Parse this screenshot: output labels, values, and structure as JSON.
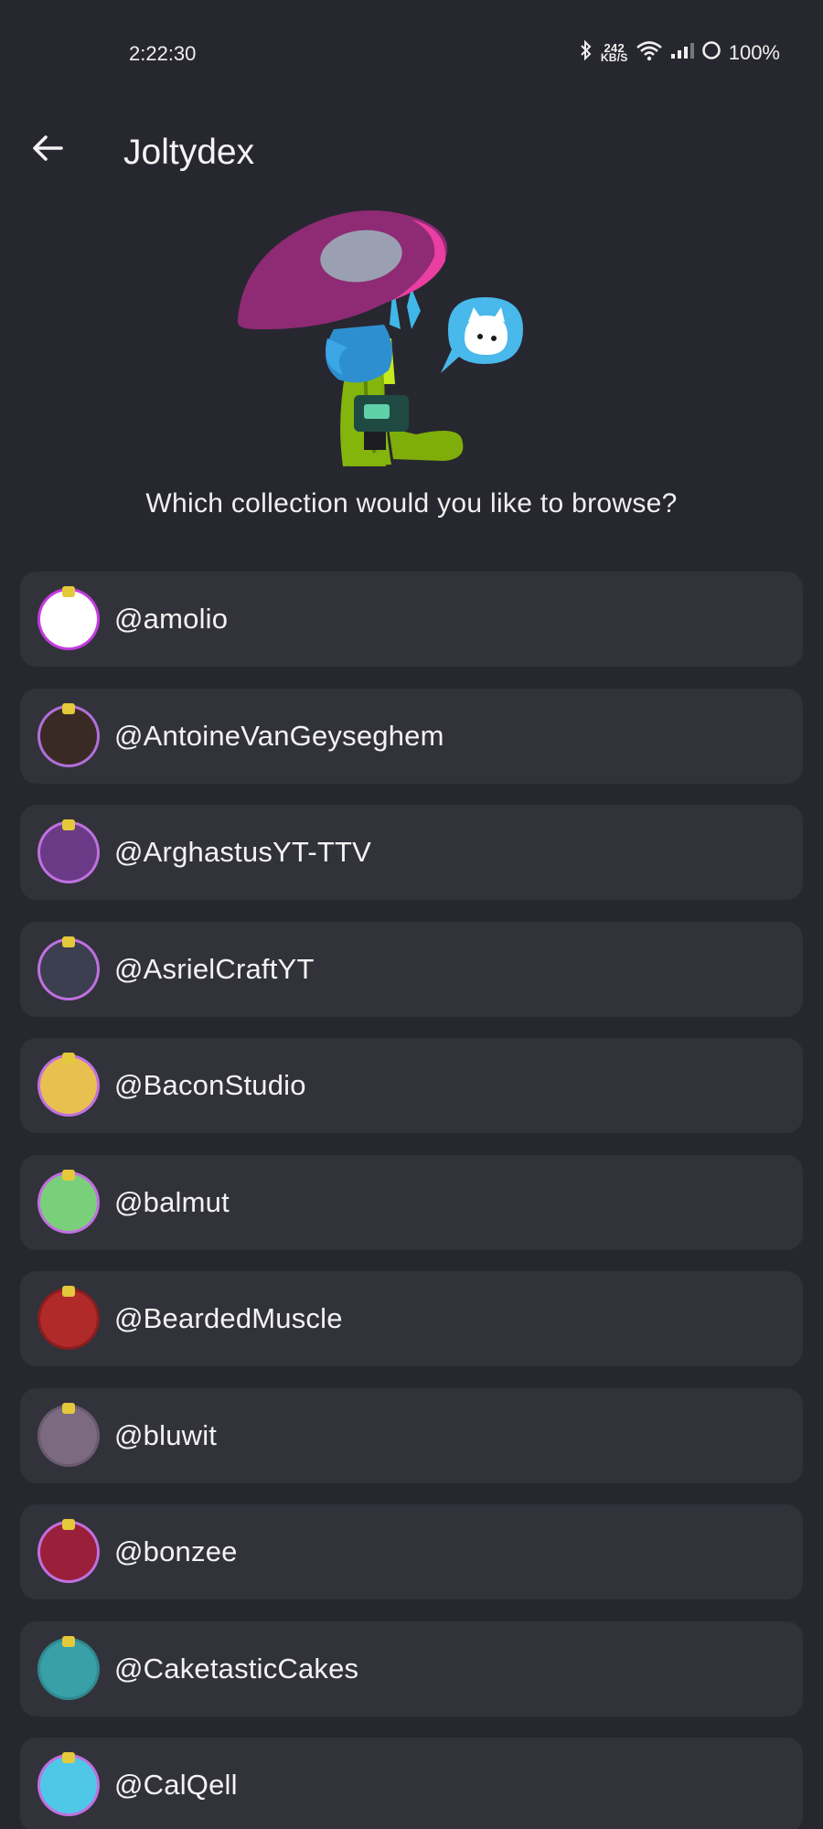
{
  "status_bar": {
    "time": "2:22:30",
    "net_speed_value": "242",
    "net_speed_unit": "KB/S",
    "battery": "100%"
  },
  "app_bar": {
    "title": "Joltydex"
  },
  "prompt": "Which collection would you like to browse?",
  "collections": [
    {
      "username": "@amolio",
      "avatar_color": "#ffffff",
      "ring_color": "#c43be0"
    },
    {
      "username": "@AntoineVanGeyseghem",
      "avatar_color": "#3a2a26",
      "ring_color": "#b070d8"
    },
    {
      "username": "@ArghastusYT-TTV",
      "avatar_color": "#6a3a86",
      "ring_color": "#c070e0"
    },
    {
      "username": "@AsrielCraftYT",
      "avatar_color": "#3b3f4f",
      "ring_color": "#c070e0"
    },
    {
      "username": "@BaconStudio",
      "avatar_color": "#e8c050",
      "ring_color": "#c070e0"
    },
    {
      "username": "@balmut",
      "avatar_color": "#7ad07a",
      "ring_color": "#c070e0"
    },
    {
      "username": "@BeardedMuscle",
      "avatar_color": "#b02a2a",
      "ring_color": "#8a1e1e"
    },
    {
      "username": "@bluwit",
      "avatar_color": "#7b6a80",
      "ring_color": "#6a5a70"
    },
    {
      "username": "@bonzee",
      "avatar_color": "#9a1f3a",
      "ring_color": "#c070e0"
    },
    {
      "username": "@CaketasticCakes",
      "avatar_color": "#3aa0a8",
      "ring_color": "#2e8a90"
    },
    {
      "username": "@CalQell",
      "avatar_color": "#4fc8e8",
      "ring_color": "#c070e0"
    }
  ]
}
